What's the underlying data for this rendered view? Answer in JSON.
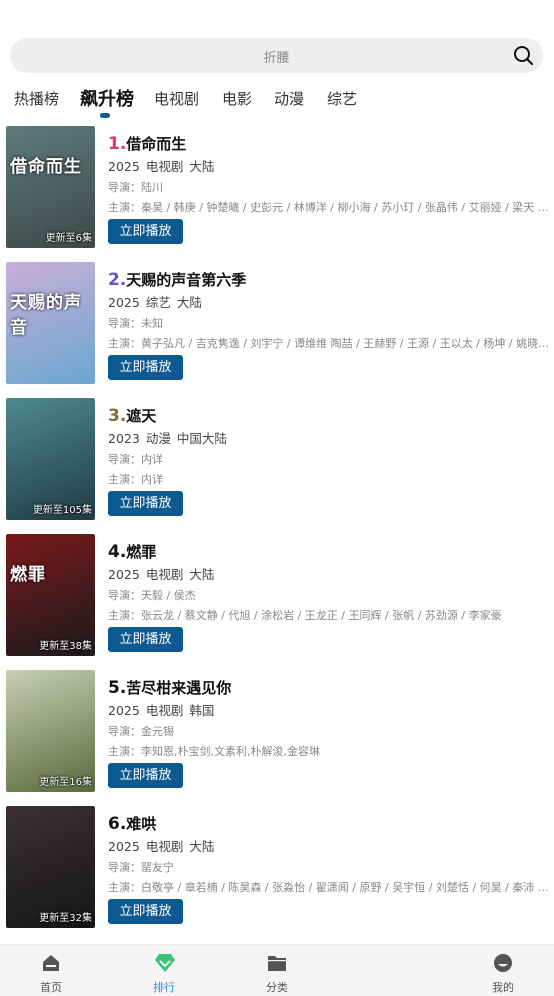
{
  "search": {
    "placeholder": "折腰"
  },
  "tabs": [
    {
      "label": "热播榜"
    },
    {
      "label": "飙升榜"
    },
    {
      "label": "电视剧"
    },
    {
      "label": "电影"
    },
    {
      "label": "动漫"
    },
    {
      "label": "综艺"
    }
  ],
  "active_tab": "飙升榜",
  "play_label": "立即播放",
  "items": [
    {
      "rank": "1.",
      "rank_color": "#e8336f",
      "title": "借命而生",
      "year": "2025",
      "genre": "电视剧",
      "region": "大陆",
      "director": "导演：陆川",
      "cast": "主演：秦昊 / 韩庚 / 钟楚曦 / 史彭元 / 林博洋 / 柳小海 / 苏小玎 / 张晶伟 / 艾丽娅 / 梁天 / 于和伟",
      "poster_caption": "更新至6集",
      "poster_title": "借命而生",
      "poster_colors": [
        "#5f7a7d",
        "#3c4a46"
      ]
    },
    {
      "rank": "2.",
      "rank_color": "#6a4fd8",
      "title": "天赐的声音第六季",
      "year": "2025",
      "genre": "综艺",
      "region": "大陆",
      "director": "导演：未知",
      "cast": "主演：黄子弘凡 / 吉克隽逸 / 刘宇宁 / 谭维维 陶喆 / 王赫野 / 王源 / 王以太 / 杨坤 / 姚晓棠 / 张靓颖",
      "poster_caption": "",
      "poster_title": "天赐的声音",
      "poster_colors": [
        "#c9b0d8",
        "#6aa6d0"
      ]
    },
    {
      "rank": "3.",
      "rank_color": "#8a6a3c",
      "title": "遮天",
      "year": "2023",
      "genre": "动漫",
      "region": "中国大陆",
      "director": "导演：内详",
      "cast": "主演：内详",
      "poster_caption": "更新至105集",
      "poster_title": "",
      "poster_colors": [
        "#4f8a8c",
        "#1f3a45"
      ]
    },
    {
      "rank": "4.",
      "rank_color": "#111111",
      "title": "燃罪",
      "year": "2025",
      "genre": "电视剧",
      "region": "大陆",
      "director": "导演：天毅 / 侯杰",
      "cast": "主演：张云龙 / 蔡文静 / 代旭 / 涂松岩 / 王龙正 / 王同辉 / 张帆 / 苏劲源 / 李家豪",
      "poster_caption": "更新至38集",
      "poster_title": "燃罪",
      "poster_colors": [
        "#7a1a1a",
        "#1a1a1e"
      ]
    },
    {
      "rank": "5.",
      "rank_color": "#111111",
      "title": "苦尽柑来遇见你",
      "year": "2025",
      "genre": "电视剧",
      "region": "韩国",
      "director": "导演：金元锡",
      "cast": "主演：李知恩,朴宝剑,文素利,朴解浚,金容琳",
      "poster_caption": "更新至16集",
      "poster_title": "",
      "poster_colors": [
        "#c8cfb4",
        "#5a6a3c"
      ]
    },
    {
      "rank": "6.",
      "rank_color": "#111111",
      "title": "难哄",
      "year": "2025",
      "genre": "电视剧",
      "region": "大陆",
      "director": "导演：罂友宁",
      "cast": "主演：白敬亭 / 章若楠 / 陈昊森 / 张淼怡 / 翟潇闻 / 原野 / 吴宇恒 / 刘楚恬 / 何昊 / 秦沛 / 张晓谦",
      "poster_caption": "更新至32集",
      "poster_title": "",
      "poster_colors": [
        "#3a3232",
        "#151515"
      ]
    }
  ],
  "bottom_nav": [
    {
      "label": "首页",
      "icon": "home-icon"
    },
    {
      "label": "排行",
      "icon": "ranking-icon"
    },
    {
      "label": "分类",
      "icon": "folder-icon"
    },
    {
      "label": "我的",
      "icon": "profile-icon"
    }
  ],
  "colors": {
    "accent": "#0d5a93",
    "nav_active": "#2d8fd5",
    "nav_active_icon": "#3cc47c"
  }
}
